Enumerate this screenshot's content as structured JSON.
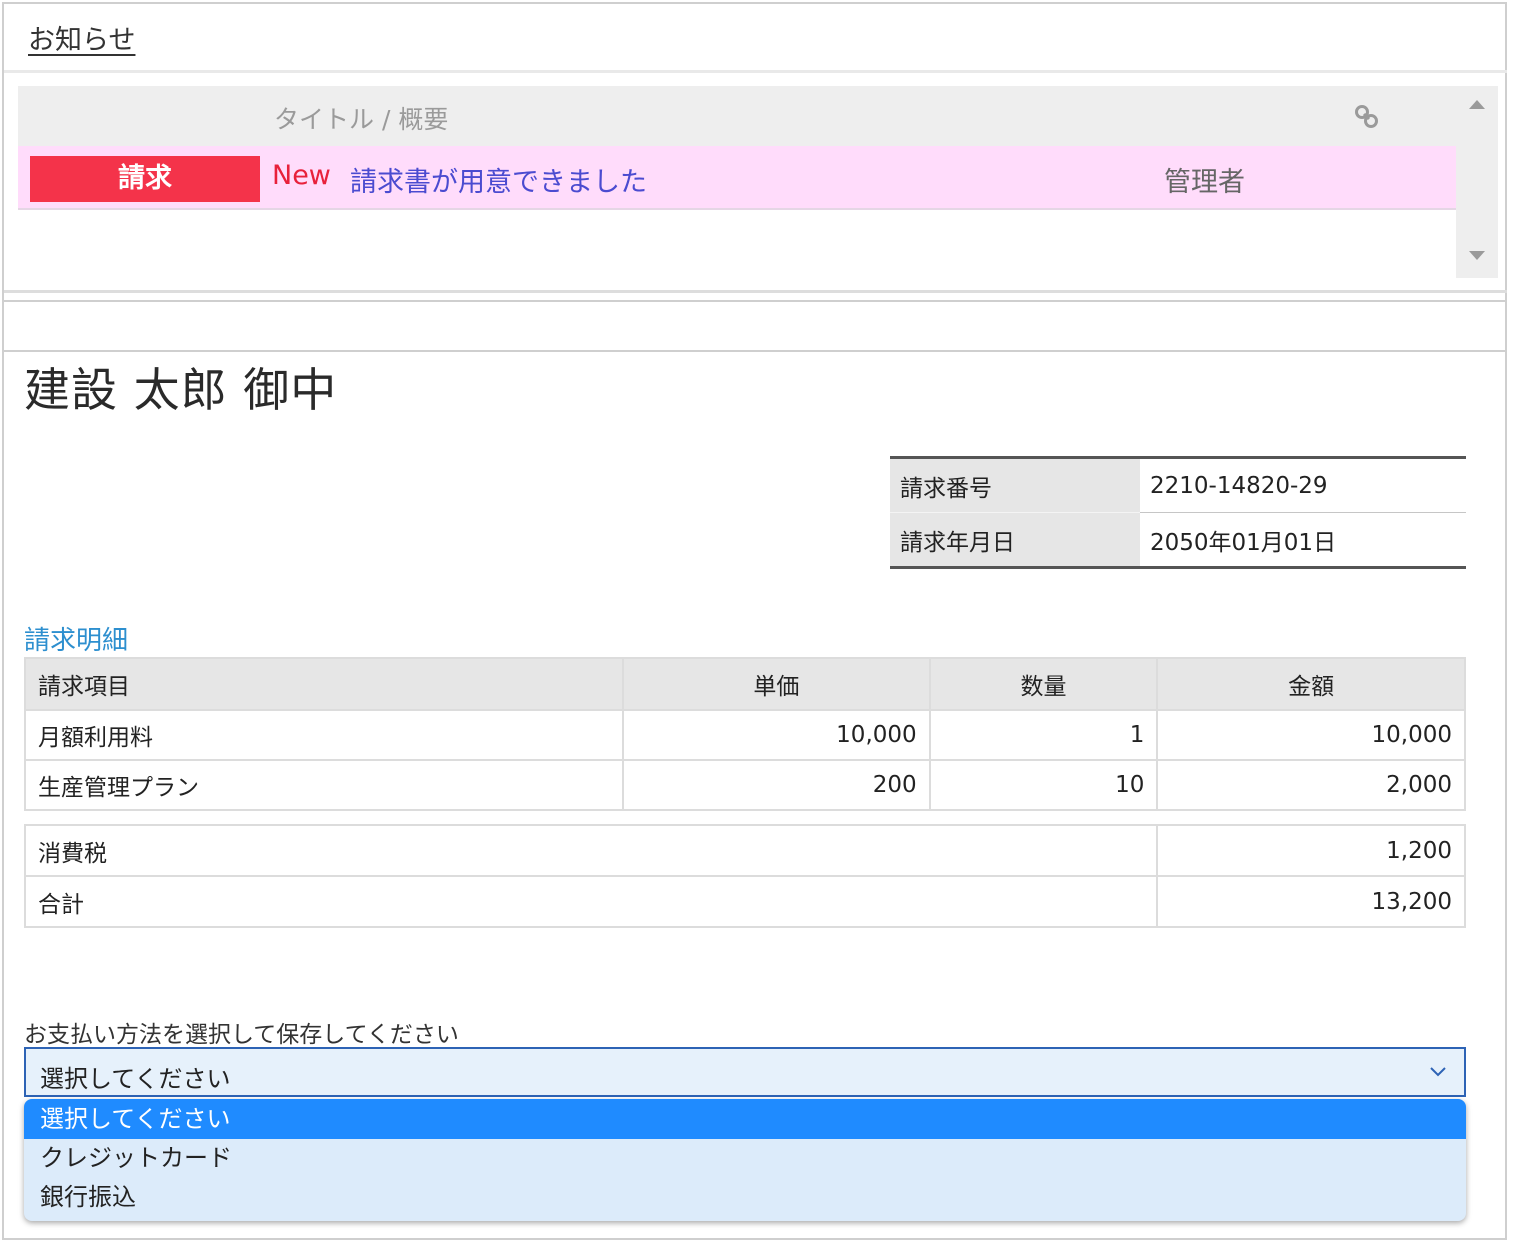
{
  "notice": {
    "title": "お知らせ",
    "column_title": "タイトル / 概要",
    "link_icon": "link-icon",
    "items": [
      {
        "category": "請求",
        "new_label": "New",
        "title": "請求書が用意できました",
        "author": "管理者"
      }
    ]
  },
  "invoice": {
    "recipient": "建設 太郎 御中",
    "meta": [
      {
        "label": "請求番号",
        "value": "2210-14820-29"
      },
      {
        "label": "請求年月日",
        "value": "2050年01月01日"
      }
    ],
    "section_title": "請求明細",
    "columns": [
      "請求項目",
      "単価",
      "数量",
      "金額"
    ],
    "rows": [
      {
        "item": "月額利用料",
        "unit_price": "10,000",
        "qty": "1",
        "amount": "10,000"
      },
      {
        "item": "生産管理プラン",
        "unit_price": "200",
        "qty": "10",
        "amount": "2,000"
      }
    ],
    "totals": [
      {
        "label": "消費税",
        "value": "1,200"
      },
      {
        "label": "合計",
        "value": "13,200"
      }
    ]
  },
  "payment": {
    "label": "お支払い方法を選択して保存してください",
    "selected": "選択してください",
    "options": [
      "選択してください",
      "クレジットカード",
      "銀行振込"
    ]
  },
  "colors": {
    "badge": "#f4334a",
    "row_highlight": "#ffdcfb",
    "link": "#4b4bd0",
    "new": "#e8213b",
    "accent": "#2d8fcf",
    "option_selected": "#1f8bff"
  }
}
